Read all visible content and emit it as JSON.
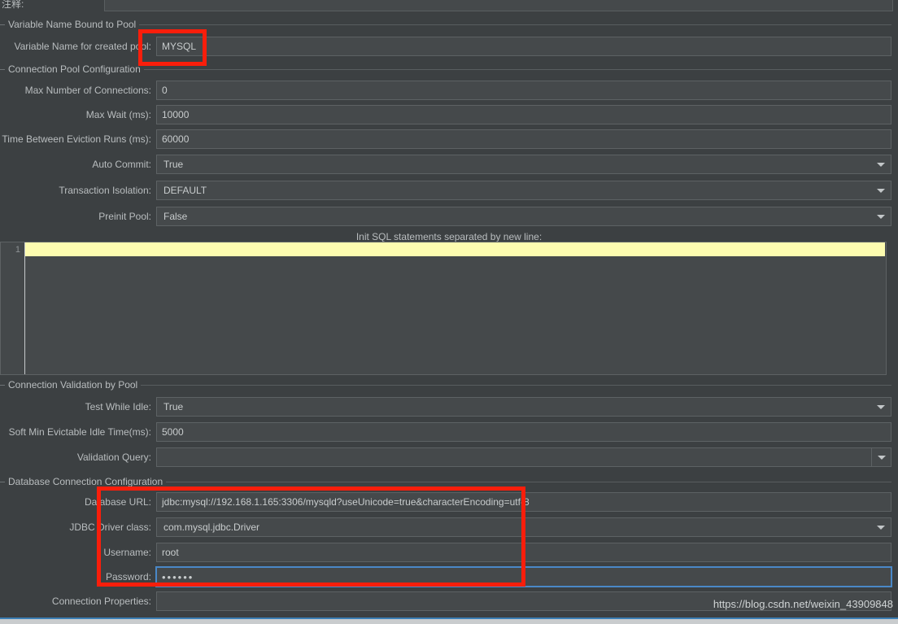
{
  "top": {
    "comment_label": "注释:",
    "comment_value": ""
  },
  "groups": {
    "variable_name": "Variable Name Bound to Pool",
    "pool_config": "Connection Pool Configuration",
    "validation": "Connection Validation by Pool",
    "db_config": "Database Connection Configuration"
  },
  "fields": {
    "variable_name": {
      "label": "Variable Name for created pool:",
      "value": "MYSQL"
    },
    "max_connections": {
      "label": "Max Number of Connections:",
      "value": "0"
    },
    "max_wait": {
      "label": "Max Wait (ms):",
      "value": "10000"
    },
    "time_between_eviction": {
      "label": "Time Between Eviction Runs (ms):",
      "value": "60000"
    },
    "auto_commit": {
      "label": "Auto Commit:",
      "value": "True"
    },
    "transaction_isolation": {
      "label": "Transaction Isolation:",
      "value": "DEFAULT"
    },
    "preinit_pool": {
      "label": "Preinit Pool:",
      "value": "False"
    },
    "test_while_idle": {
      "label": "Test While Idle:",
      "value": "True"
    },
    "soft_min_evictable": {
      "label": "Soft Min Evictable Idle Time(ms):",
      "value": "5000"
    },
    "validation_query": {
      "label": "Validation Query:",
      "value": ""
    },
    "database_url": {
      "label": "Database URL:",
      "value": "jdbc:mysql://192.168.1.165:3306/mysqld?useUnicode=true&characterEncoding=utf-8"
    },
    "jdbc_driver_class": {
      "label": "JDBC Driver class:",
      "value": "com.mysql.jdbc.Driver"
    },
    "username": {
      "label": "Username:",
      "value": "root"
    },
    "password": {
      "label": "Password:",
      "value": "••••••"
    },
    "connection_properties": {
      "label": "Connection Properties:",
      "value": ""
    }
  },
  "sql_editor": {
    "header": "Init SQL statements separated by new line:",
    "line_number": "1",
    "content": ""
  },
  "watermark": "https://blog.csdn.net/weixin_43909848",
  "colors": {
    "background": "#3c4042",
    "field_bg": "#45494b",
    "border": "#5d6264",
    "text": "#c8cccd",
    "label": "#b9bdbf",
    "annotation_red": "#f91e0b",
    "focus_blue": "#4a88c7",
    "current_line_yellow": "#fdfcb0"
  }
}
